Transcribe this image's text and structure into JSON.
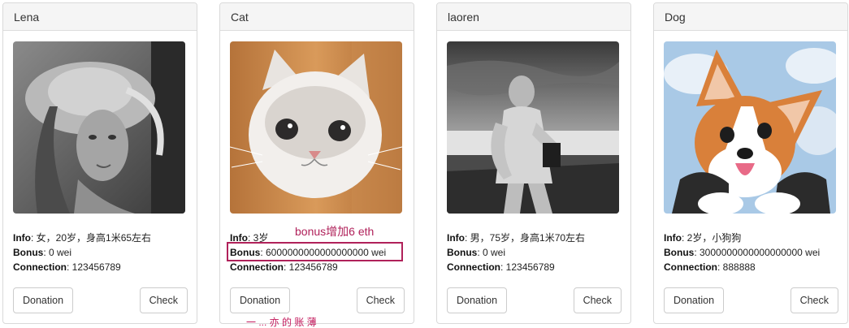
{
  "labels": {
    "info": "Info",
    "bonus": "Bonus",
    "connection": "Connection",
    "donation_button": "Donation",
    "check_button": "Check"
  },
  "cards": [
    {
      "name": "Lena",
      "image": "lena-portrait-grayscale",
      "info": ": 女，20岁，身高1米65左右",
      "bonus": ": 0 wei",
      "connection": ": 123456789"
    },
    {
      "name": "Cat",
      "image": "fluffy-kitten-photo",
      "info": ": 3岁",
      "bonus": ": 6000000000000000000 wei",
      "connection": ": 123456789"
    },
    {
      "name": "laoren",
      "image": "old-man-boat-grayscale",
      "info": ": 男，75岁，身高1米70左右",
      "bonus": ": 0 wei",
      "connection": ": 123456789"
    },
    {
      "name": "Dog",
      "image": "corgi-dog-photo",
      "info": ": 2岁，小狗狗",
      "bonus": ": 3000000000000000000 wei",
      "connection": ": 888888"
    }
  ],
  "annotations": {
    "bonus_note": "bonus增加6 eth",
    "bottom_note_partial": "一 ... 亦 的 账 薄"
  },
  "colors": {
    "annotation": "#b0215a",
    "panel_heading_bg": "#f5f5f5",
    "border": "#dddddd"
  }
}
